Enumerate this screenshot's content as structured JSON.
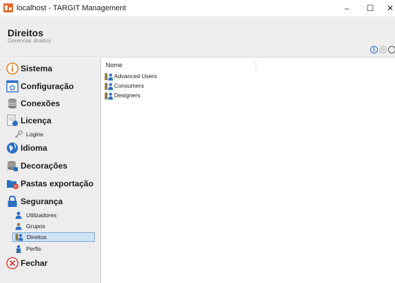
{
  "window": {
    "title": "localhost - TARGIT Management",
    "minimize_glyph": "–",
    "maximize_glyph": "☐",
    "close_glyph": "✕"
  },
  "header": {
    "title": "Direitos",
    "subtitle": "Gerenciar direitos",
    "icons": [
      "info-icon",
      "globe-icon",
      "clock-icon"
    ]
  },
  "sidebar": {
    "items": [
      {
        "label": "Sistema",
        "icon": "info-icon"
      },
      {
        "label": "Configuração",
        "icon": "config-icon"
      },
      {
        "label": "Conexões",
        "icon": "database-icon"
      },
      {
        "label": "Licença",
        "icon": "license-icon"
      },
      {
        "label": "Logins",
        "icon": "key-icon",
        "sub": true
      },
      {
        "label": "Idioma",
        "icon": "globe-icon"
      },
      {
        "label": "Decorações",
        "icon": "decorations-icon"
      },
      {
        "label": "Pastas exportação",
        "icon": "export-folder-icon"
      },
      {
        "label": "Segurança",
        "icon": "lock-icon"
      },
      {
        "label": "Utilizadores",
        "icon": "user-icon",
        "sub": true
      },
      {
        "label": "Grupos",
        "icon": "group-icon",
        "sub": true
      },
      {
        "label": "Direitos",
        "icon": "rights-icon",
        "sub": true,
        "selected": true
      },
      {
        "label": "Perfis",
        "icon": "profile-icon",
        "sub": true
      },
      {
        "label": "Fechar",
        "icon": "close-circle-icon"
      }
    ]
  },
  "main": {
    "column_header": "Nome",
    "rows": [
      "Advanced Users",
      "Consumers",
      "Designers"
    ]
  },
  "colors": {
    "accent": "#2c6fc3",
    "selection": "#cfe3f7",
    "sidebar_bg": "#ededed",
    "close_red": "#d9433a"
  }
}
